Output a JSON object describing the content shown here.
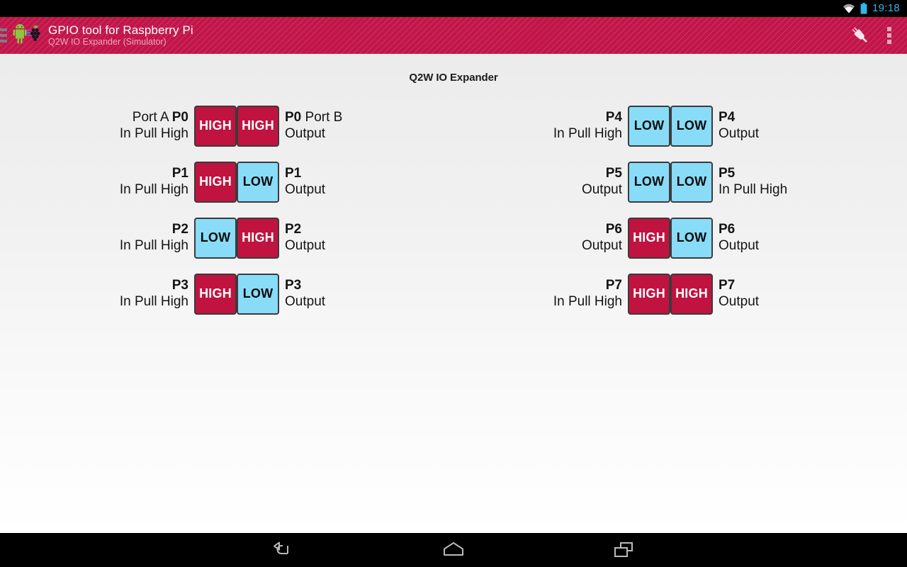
{
  "status_bar": {
    "time": "19:18",
    "wifi_icon": "wifi-icon",
    "battery_icon": "battery-icon",
    "accent_color": "#33b5e5"
  },
  "action_bar": {
    "title": "GPIO tool for Raspberry Pi",
    "subtitle": "Q2W IO Expander (Simulator)",
    "background_color": "#c2154a",
    "drawer_indicator": "drawer-indicator",
    "app_icon": "android-raspberrypi-icon",
    "actions": [
      {
        "name": "connect-plug-icon",
        "label": "Connect"
      },
      {
        "name": "overflow-menu-icon",
        "label": "More options"
      }
    ]
  },
  "panel": {
    "title": "Q2W IO Expander"
  },
  "colors": {
    "high": "#c1133f",
    "high_text": "#ffffff",
    "low": "#88dcf7",
    "low_text": "#0a0a0a",
    "border": "#3b3b3b"
  },
  "ports": {
    "port_a_label": "Port A",
    "port_b_label": "Port B",
    "groups": [
      {
        "group": "left",
        "columns": [
          {
            "side": "right-aligned",
            "port_label": "Port A",
            "pins": [
              {
                "pin": "P0",
                "mode": "In Pull High",
                "state": "HIGH"
              },
              {
                "pin": "P1",
                "mode": "In Pull High",
                "state": "HIGH"
              },
              {
                "pin": "P2",
                "mode": "In Pull High",
                "state": "LOW"
              },
              {
                "pin": "P3",
                "mode": "In Pull High",
                "state": "HIGH"
              }
            ]
          },
          {
            "side": "left-aligned",
            "port_label": "Port B",
            "pins": [
              {
                "pin": "P0",
                "mode": "Output",
                "state": "HIGH"
              },
              {
                "pin": "P1",
                "mode": "Output",
                "state": "LOW"
              },
              {
                "pin": "P2",
                "mode": "Output",
                "state": "HIGH"
              },
              {
                "pin": "P3",
                "mode": "Output",
                "state": "LOW"
              }
            ]
          }
        ]
      },
      {
        "group": "right",
        "columns": [
          {
            "side": "right-aligned",
            "port_label": "",
            "pins": [
              {
                "pin": "P4",
                "mode": "In Pull High",
                "state": "LOW"
              },
              {
                "pin": "P5",
                "mode": "Output",
                "state": "LOW"
              },
              {
                "pin": "P6",
                "mode": "Output",
                "state": "HIGH"
              },
              {
                "pin": "P7",
                "mode": "In Pull High",
                "state": "HIGH"
              }
            ]
          },
          {
            "side": "left-aligned",
            "port_label": "",
            "pins": [
              {
                "pin": "P4",
                "mode": "Output",
                "state": "LOW"
              },
              {
                "pin": "P5",
                "mode": "In Pull High",
                "state": "LOW"
              },
              {
                "pin": "P6",
                "mode": "Output",
                "state": "LOW"
              },
              {
                "pin": "P7",
                "mode": "Output",
                "state": "HIGH"
              }
            ]
          }
        ]
      }
    ]
  },
  "nav_bar": {
    "buttons": [
      {
        "name": "nav-back-icon",
        "label": "Back"
      },
      {
        "name": "nav-home-icon",
        "label": "Home"
      },
      {
        "name": "nav-recents-icon",
        "label": "Recents"
      }
    ]
  }
}
